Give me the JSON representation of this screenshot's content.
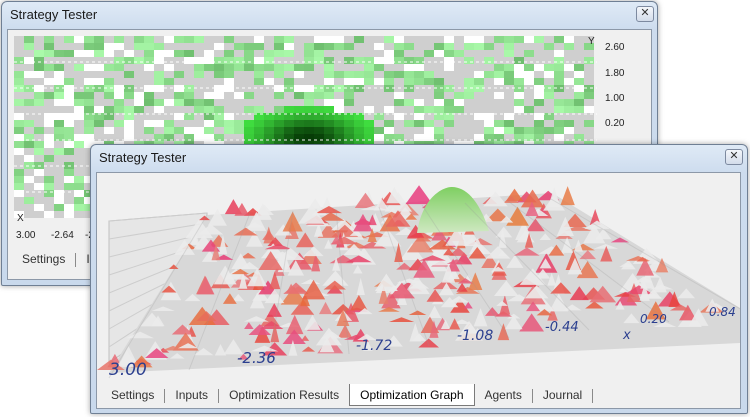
{
  "back_window": {
    "title": "Strategy Tester",
    "close_glyph": "✕",
    "y_axis_name": "Y",
    "x_axis_name": "X",
    "y_ticks": [
      "2.60",
      "1.80",
      "1.00",
      "0.20"
    ],
    "x_ticks": [
      "3.00",
      "-2.64",
      "-2."
    ],
    "tabs": [
      "Settings",
      "In"
    ]
  },
  "front_window": {
    "title": "Strategy Tester",
    "close_glyph": "✕",
    "axis_labels": [
      "3.00",
      "-2.36",
      "-1.72",
      "-1.08",
      "-0.44",
      "0.20",
      "0.84"
    ],
    "axis_name": "x",
    "tabs": [
      "Settings",
      "Inputs",
      "Optimization Results",
      "Optimization Graph",
      "Agents",
      "Journal"
    ],
    "active_tab": "Optimization Graph"
  },
  "colors": {
    "heatmap_green": "#2f8f2f",
    "heatmap_gray": "#c8c8c8",
    "surface_red": "#e84848",
    "surface_peak_green": "#8fd07a",
    "axis_text_blue": "#2b3f8f"
  }
}
